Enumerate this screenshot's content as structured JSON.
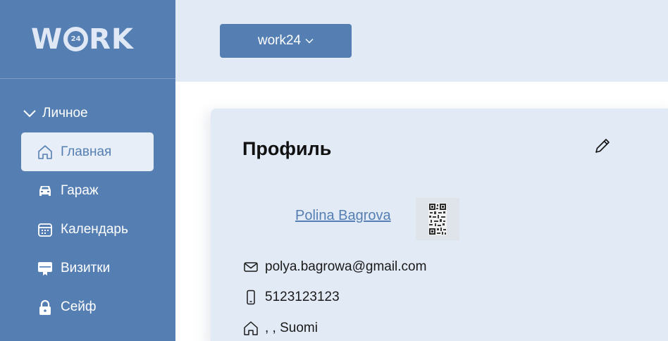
{
  "brand": {
    "logo_left": "W",
    "logo_badge": "24",
    "logo_right": "RK"
  },
  "sidebar": {
    "section_label": "Личное",
    "items": [
      {
        "label": "Главная",
        "icon": "home-icon",
        "active": true
      },
      {
        "label": "Гараж",
        "icon": "car-icon"
      },
      {
        "label": "Календарь",
        "icon": "calendar-icon"
      },
      {
        "label": "Визитки",
        "icon": "business-card-icon"
      },
      {
        "label": "Сейф",
        "icon": "lock-icon"
      }
    ]
  },
  "topbar": {
    "org_selector_label": "work24"
  },
  "profile": {
    "title": "Профиль",
    "name": "Polina Bagrova",
    "email": "polya.bagrowa@gmail.com",
    "phone": "5123123123",
    "address": ", , Suomi"
  },
  "colors": {
    "primary": "#557fb3",
    "panel": "#e2eaf6",
    "active_bg": "#e8eef7"
  }
}
